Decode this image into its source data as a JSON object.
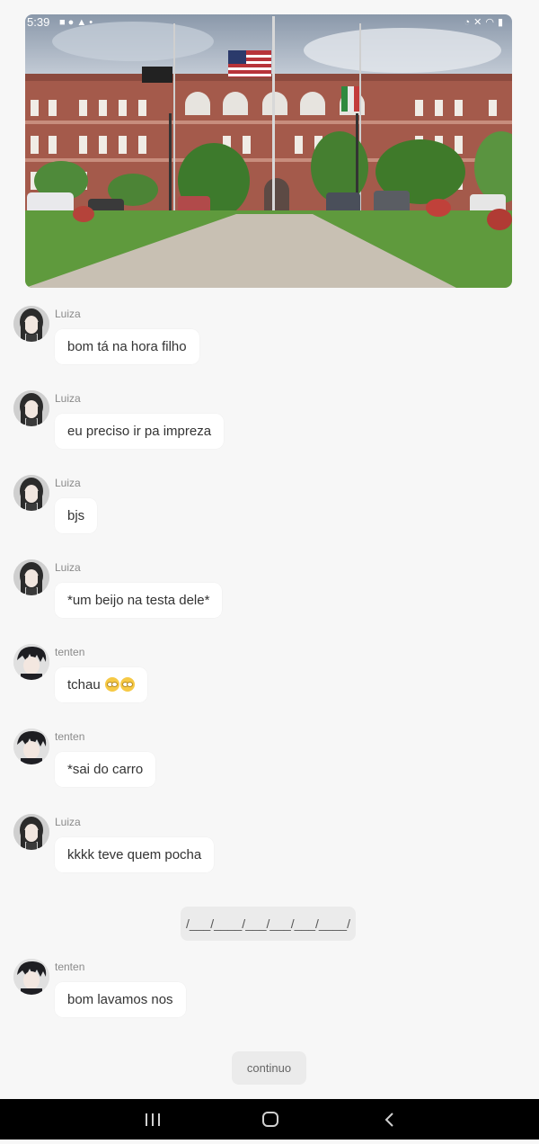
{
  "status_bar": {
    "time": "5:39",
    "left_icons": [
      "photo-icon",
      "pinterest-icon",
      "warning-icon",
      "dot-icon"
    ],
    "right_icons": [
      "alarm-icon",
      "mute-icon",
      "wifi-icon",
      "battery-icon"
    ]
  },
  "hero_image": {
    "subject": "school-building"
  },
  "messages": [
    {
      "sender": "Luiza",
      "text": "bom tá na hora filho",
      "avatar": "luiza-avatar"
    },
    {
      "sender": "Luiza",
      "text": "eu preciso ir pa impreza",
      "avatar": "luiza-avatar"
    },
    {
      "sender": "Luiza",
      "text": "bjs",
      "avatar": "luiza-avatar"
    },
    {
      "sender": "Luiza",
      "text": "*um beijo na testa dele*",
      "avatar": "luiza-avatar"
    },
    {
      "sender": "tenten",
      "text": "tchau",
      "emoji_count": 2,
      "avatar": "tenten-avatar"
    },
    {
      "sender": "tenten",
      "text": "*sai do carro",
      "avatar": "tenten-avatar"
    },
    {
      "sender": "Luiza",
      "text": "kkkk teve quem pocha",
      "avatar": "luiza-avatar"
    },
    {
      "sender": "tenten",
      "text": "bom lavamos nos",
      "avatar": "tenten-avatar"
    }
  ],
  "scene_divider": "/___/____/___/___/___/____/",
  "continue_button": "continuo",
  "nav_bar": {
    "buttons": [
      "recent-apps-icon",
      "home-icon",
      "back-icon"
    ]
  },
  "colors": {
    "background": "#f7f7f7",
    "bubble": "#ffffff",
    "chip": "#ebebeb",
    "nav": "#000000"
  }
}
